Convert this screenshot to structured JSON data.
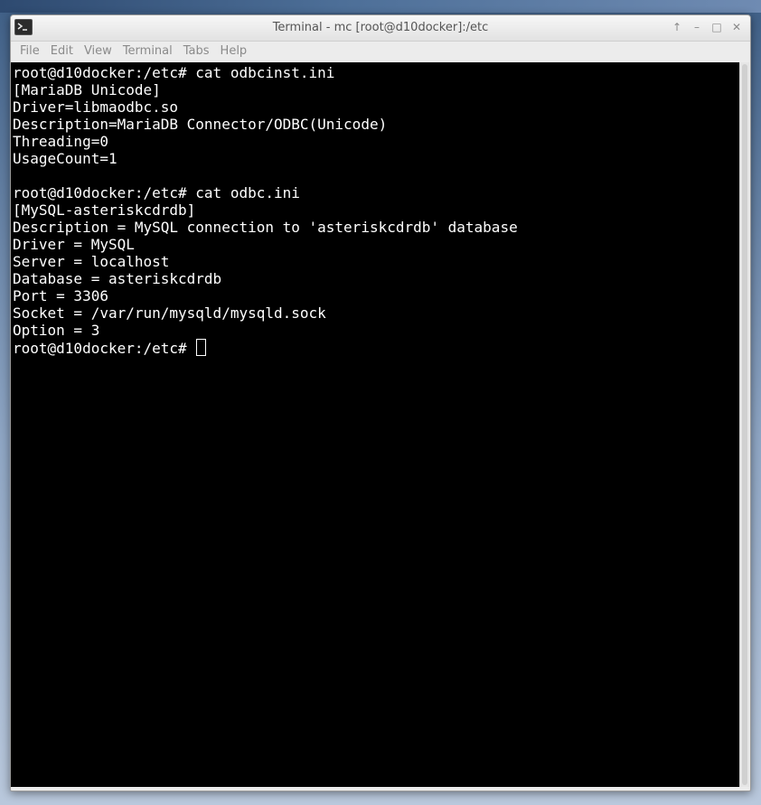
{
  "window": {
    "title": "Terminal - mc [root@d10docker]:/etc",
    "controls": {
      "up": "↑",
      "minimize": "–",
      "maximize": "□",
      "close": "✕"
    }
  },
  "menubar": {
    "items": [
      {
        "label": "File"
      },
      {
        "label": "Edit"
      },
      {
        "label": "View"
      },
      {
        "label": "Terminal"
      },
      {
        "label": "Tabs"
      },
      {
        "label": "Help"
      }
    ]
  },
  "terminal": {
    "lines": [
      "root@d10docker:/etc# cat odbcinst.ini",
      "[MariaDB Unicode]",
      "Driver=libmaodbc.so",
      "Description=MariaDB Connector/ODBC(Unicode)",
      "Threading=0",
      "UsageCount=1",
      "",
      "root@d10docker:/etc# cat odbc.ini",
      "[MySQL-asteriskcdrdb]",
      "Description = MySQL connection to 'asteriskcdrdb' database",
      "Driver = MySQL",
      "Server = localhost",
      "Database = asteriskcdrdb",
      "Port = 3306",
      "Socket = /var/run/mysqld/mysqld.sock",
      "Option = 3"
    ],
    "prompt": "root@d10docker:/etc# "
  },
  "colors": {
    "terminal_bg": "#000000",
    "terminal_fg": "#ffffff",
    "chrome_bg": "#ececec",
    "menu_text": "#8a8a8a"
  },
  "icons": {
    "app": "terminal-icon",
    "up": "arrow-up-icon",
    "minimize": "minimize-icon",
    "maximize": "maximize-icon",
    "close": "close-icon"
  }
}
